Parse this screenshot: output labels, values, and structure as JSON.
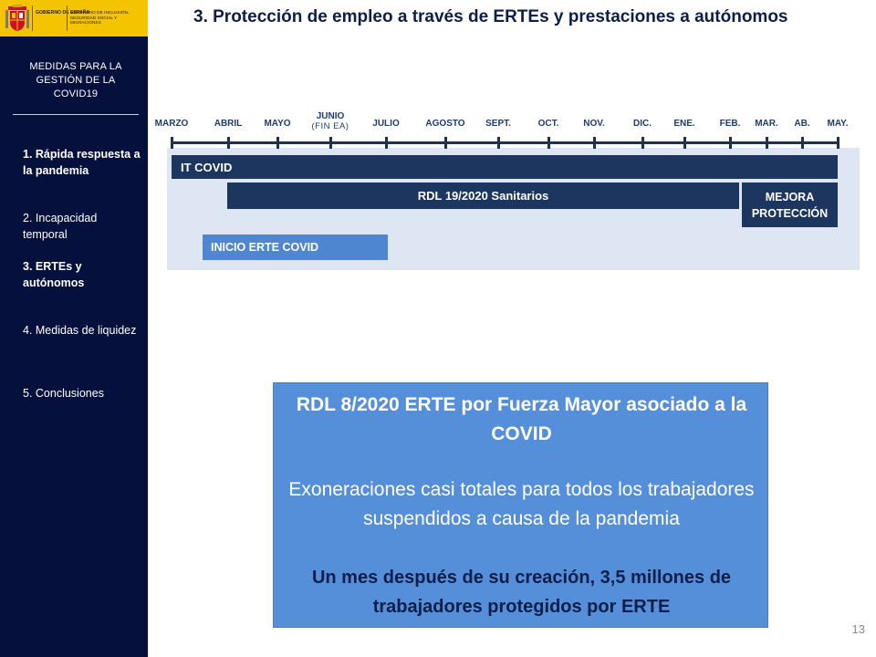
{
  "header": {
    "logo_gov_text": "GOBIERNO DE ESPAÑA",
    "logo_ministry_text": "MINISTERIO DE INCLUSIÓN, SEGURIDAD SOCIAL Y MIGRACIONES",
    "title": "3. Protección de empleo a través de ERTEs y prestaciones a autónomos"
  },
  "sidebar": {
    "heading": "MEDIDAS  PARA LA GESTIÓN DE LA COVID19",
    "items": [
      {
        "label": "1. Rápida respuesta a la pandemia"
      },
      {
        "label": "2. Incapacidad temporal"
      },
      {
        "label": "3. ERTEs y autónomos"
      },
      {
        "label": "4. Medidas de liquidez"
      },
      {
        "label": "5. Conclusiones"
      }
    ]
  },
  "timeline": {
    "months": [
      {
        "label": "MARZO"
      },
      {
        "label": "ABRIL"
      },
      {
        "label": "MAYO"
      },
      {
        "label": "JUNIO",
        "sub": "(FIN EA)"
      },
      {
        "label": "JULIO"
      },
      {
        "label": "AGOSTO"
      },
      {
        "label": "SEPT."
      },
      {
        "label": "OCT."
      },
      {
        "label": "NOV."
      },
      {
        "label": "DIC."
      },
      {
        "label": "ENE."
      },
      {
        "label": "FEB."
      },
      {
        "label": "MAR."
      },
      {
        "label": "AB."
      },
      {
        "label": "MAY."
      }
    ],
    "bars": {
      "it_covid": "IT COVID",
      "rdl19": "RDL 19/2020 Sanitarios",
      "mejora": "MEJORA PROTECCIÓN",
      "inicio_erte": "INICIO ERTE COVID"
    }
  },
  "info_box": {
    "title": "RDL 8/2020 ERTE por Fuerza Mayor asociado a la COVID",
    "body": "Exoneraciones casi totales para todos los trabajadores suspendidos a causa de la pandemia",
    "highlight": "Un mes después de su creación, 3,5 millones de trabajadores protegidos por ERTE"
  },
  "page_number": "13",
  "colors": {
    "navy": "#05103d",
    "bar_dark": "#1c3660",
    "bar_light": "#4f86d0",
    "info_box": "#568fd9",
    "logo_yellow": "#f5c400"
  }
}
